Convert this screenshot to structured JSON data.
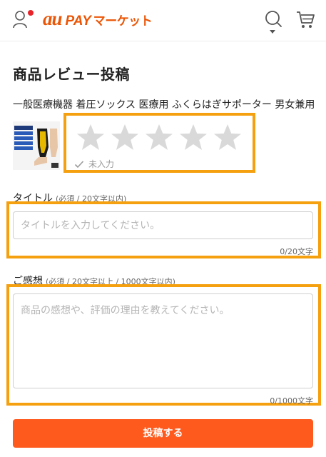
{
  "header": {
    "brand_au": "au",
    "brand_pay": "PAY",
    "brand_market": "マーケット",
    "user_icon": "user-icon",
    "search_icon": "search-icon",
    "cart_icon": "cart-icon",
    "notification_dot_color": "#e8242a",
    "brand_color": "#eb5505"
  },
  "page": {
    "title": "商品レビュー投稿",
    "product_name": "一般医療機器 着圧ソックス 医療用 ふくらはぎサポーター 男女兼用"
  },
  "rating": {
    "star_count": 5,
    "selected": 0,
    "status_text": "未入力",
    "star_color": "#d9d9d9"
  },
  "title_field": {
    "label": "タイトル",
    "note": "(必須 / 20文字以内)",
    "placeholder": "タイトルを入力してください。",
    "value": "",
    "counter": "0/20文字"
  },
  "review_field": {
    "label": "ご感想",
    "note": "(必須 / 20文字以上 / 1000文字以内)",
    "placeholder": "商品の感想や、評価の理由を教えてください。",
    "value": "",
    "counter": "0/1000文字"
  },
  "submit": {
    "label": "投稿する",
    "color": "#ff5a1e"
  },
  "highlight_color": "#f5a00f"
}
